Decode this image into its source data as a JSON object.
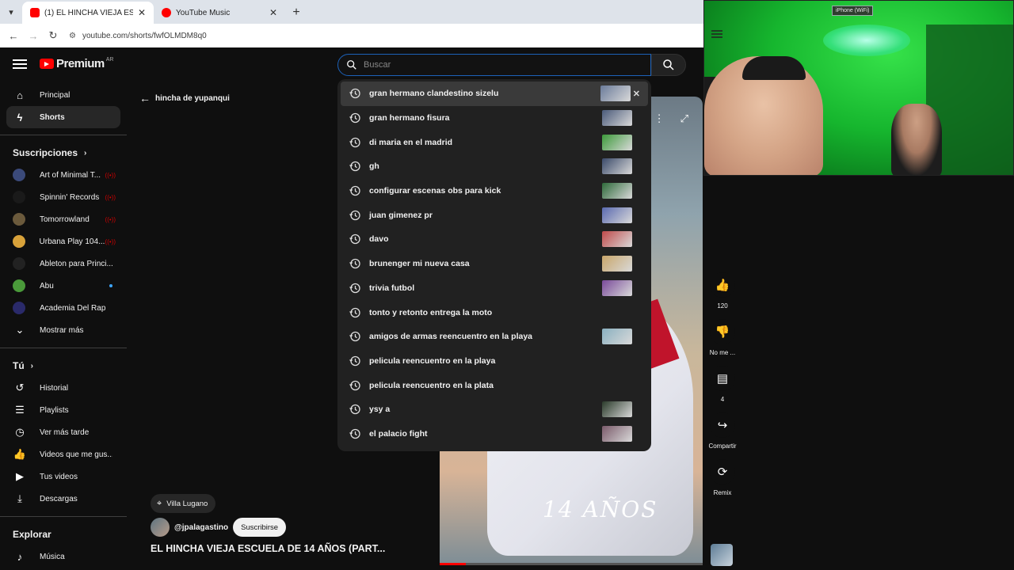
{
  "browser": {
    "tabs": [
      {
        "title": "(1) EL HINCHA VIEJA ESCUELA DE",
        "active": true,
        "favicon": "youtube-icon"
      },
      {
        "title": "YouTube Music",
        "active": false,
        "favicon": "youtube-music-icon"
      }
    ],
    "url": "youtube.com/shorts/fwfOLMDM8q0"
  },
  "masthead": {
    "logo_text": "Premium",
    "country": "AR",
    "search_placeholder": "Buscar"
  },
  "sidebar": {
    "main": [
      {
        "label": "Principal",
        "icon": "home-icon"
      },
      {
        "label": "Shorts",
        "icon": "shorts-icon",
        "active": true
      }
    ],
    "subs_title": "Suscripciones",
    "subscriptions": [
      {
        "label": "Art of Minimal T...",
        "color": "#3b4a7a",
        "status": "live"
      },
      {
        "label": "Spinnin' Records",
        "color": "#1a1a1a",
        "status": "live"
      },
      {
        "label": "Tomorrowland",
        "color": "#6b5a3c",
        "status": "live"
      },
      {
        "label": "Urbana Play 104....",
        "color": "#d8a23a",
        "status": "live"
      },
      {
        "label": "Ableton para Princi...",
        "color": "#222222",
        "status": ""
      },
      {
        "label": "Abu",
        "color": "#4a9a3a",
        "status": "new"
      },
      {
        "label": "Academia Del Rap",
        "color": "#2a2a6a",
        "status": ""
      }
    ],
    "show_more": "Mostrar más",
    "you_title": "Tú",
    "you": [
      {
        "label": "Historial",
        "icon": "history-icon"
      },
      {
        "label": "Playlists",
        "icon": "playlists-icon"
      },
      {
        "label": "Ver más tarde",
        "icon": "watch-later-icon"
      },
      {
        "label": "Videos que me gus...",
        "icon": "like-icon"
      },
      {
        "label": "Tus videos",
        "icon": "your-videos-icon"
      },
      {
        "label": "Descargas",
        "icon": "download-icon"
      }
    ],
    "explore_title": "Explorar",
    "explore": [
      {
        "label": "Música",
        "icon": "music-icon"
      }
    ]
  },
  "back_label": "hincha de yupanqui",
  "suggestions": [
    {
      "text": "gran hermano clandestino sizelu",
      "thumb": "#6a7b9a",
      "hover": true
    },
    {
      "text": "gran hermano fisura",
      "thumb": "#4a5a7a"
    },
    {
      "text": "di maria en el madrid",
      "thumb": "#3c9a3a"
    },
    {
      "text": "gh",
      "thumb": "#3a4a6a"
    },
    {
      "text": "configurar escenas obs para kick",
      "thumb": "#2e6a3a"
    },
    {
      "text": "juan gimenez pr",
      "thumb": "#5a6ab0"
    },
    {
      "text": "davo",
      "thumb": "#c04a4a"
    },
    {
      "text": "brunenger mi nueva casa",
      "thumb": "#c9a66a"
    },
    {
      "text": "trivia futbol",
      "thumb": "#7a4a9a"
    },
    {
      "text": "tonto y retonto entrega la moto",
      "thumb": ""
    },
    {
      "text": "amigos de armas reencuentro en la playa",
      "thumb": "#8ab0c0"
    },
    {
      "text": "pelicula reencuentro en la playa",
      "thumb": ""
    },
    {
      "text": "pelicula reencuentro en la plata",
      "thumb": ""
    },
    {
      "text": "ysy a",
      "thumb": "#2a3a2a"
    },
    {
      "text": "el palacio fight",
      "thumb": "#7a5a6a"
    }
  ],
  "video": {
    "caption": "14 AÑOS",
    "progress_fraction": 0.1,
    "location": "Villa Lugano",
    "channel": "@jpalagastino",
    "subscribe": "Suscribirse",
    "title": "EL HINCHA VIEJA ESCUELA DE 14 AÑOS (PART..."
  },
  "actions": [
    {
      "icon": "like-icon",
      "label": "120"
    },
    {
      "icon": "dislike-icon",
      "label": "No me ..."
    },
    {
      "icon": "comment-icon",
      "label": "4"
    },
    {
      "icon": "share-icon",
      "label": "Compartir"
    },
    {
      "icon": "remix-icon",
      "label": "Remix"
    }
  ],
  "webcam": {
    "tag": "iPhone (WiFi)"
  }
}
